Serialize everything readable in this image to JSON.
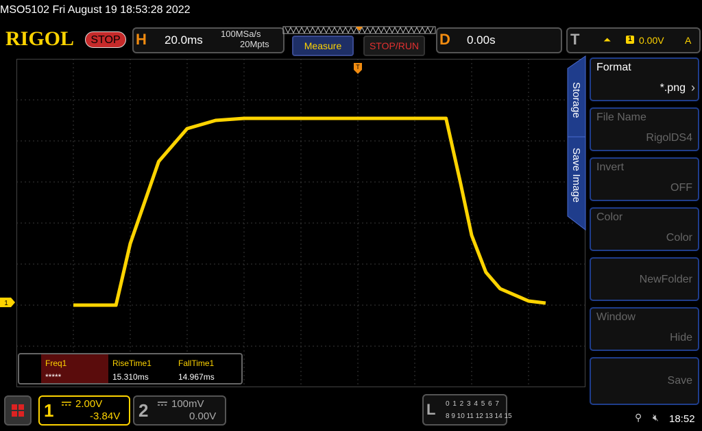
{
  "titlebar": {
    "text": "MSO5102  Fri August 19 18:53:28 2022"
  },
  "logo": "RIGOL",
  "run_state": "STOP",
  "horizontal": {
    "letter": "H",
    "timebase": "20.0ms",
    "sample_rate": "100MSa/s",
    "memory_depth": "20Mpts"
  },
  "buttons": {
    "measure": "Measure",
    "stop_run": "STOP/RUN"
  },
  "delay": {
    "letter": "D",
    "value": "0.00s"
  },
  "trigger": {
    "letter": "T",
    "slope_symbol": "⏶",
    "channel": "1",
    "level": "0.00V",
    "mode": "A"
  },
  "measurements": [
    {
      "name": "Freq1",
      "value": "*****"
    },
    {
      "name": "RiseTime1",
      "value": "15.310ms"
    },
    {
      "name": "FallTime1",
      "value": "14.967ms"
    }
  ],
  "sidebar": {
    "tabs": [
      "Storage",
      "Save Image"
    ],
    "items": [
      {
        "label": "Format",
        "value": "*.png",
        "enabled": true
      },
      {
        "label": "File Name",
        "value": "RigolDS4",
        "enabled": false
      },
      {
        "label": "Invert",
        "value": "OFF",
        "enabled": false
      },
      {
        "label": "Color",
        "value": "Color",
        "enabled": false
      },
      {
        "label": "",
        "value": "NewFolder",
        "enabled": false
      },
      {
        "label": "Window",
        "value": "Hide",
        "enabled": false
      },
      {
        "label": "",
        "value": "Save",
        "enabled": false
      }
    ]
  },
  "channels": [
    {
      "number": "1",
      "scale": "2.00V",
      "offset": "-3.84V",
      "coupling_icon": "dc-coupling-icon"
    },
    {
      "number": "2",
      "scale": "100mV",
      "offset": "0.00V",
      "coupling_icon": "dc-coupling-icon"
    }
  ],
  "logic": {
    "letter": "L",
    "row1": "0 1 2 3  4 5 6 7",
    "row2": "8 9 10 11 12 13 14 15"
  },
  "status": {
    "clock": "18:52",
    "usb_icon": "usb-icon",
    "speaker_icon": "speaker-muted-icon"
  },
  "colors": {
    "ch1": "#ffd400",
    "stop": "#c62a2a",
    "trigger": "#f28c10",
    "accent_blue": "#1f3d8c"
  },
  "trace_ch1": {
    "x_ms": [
      -100,
      -85,
      -80,
      -70,
      -60,
      -50,
      -40,
      -20,
      0,
      20,
      31,
      36,
      40,
      45,
      50,
      60,
      66
    ],
    "y_div": [
      -2.0,
      -2.0,
      -0.5,
      1.5,
      2.3,
      2.5,
      2.55,
      2.55,
      2.55,
      2.55,
      2.55,
      1.0,
      -0.3,
      -1.2,
      -1.6,
      -1.9,
      -1.95
    ]
  },
  "ch1_ground_marker": "1"
}
